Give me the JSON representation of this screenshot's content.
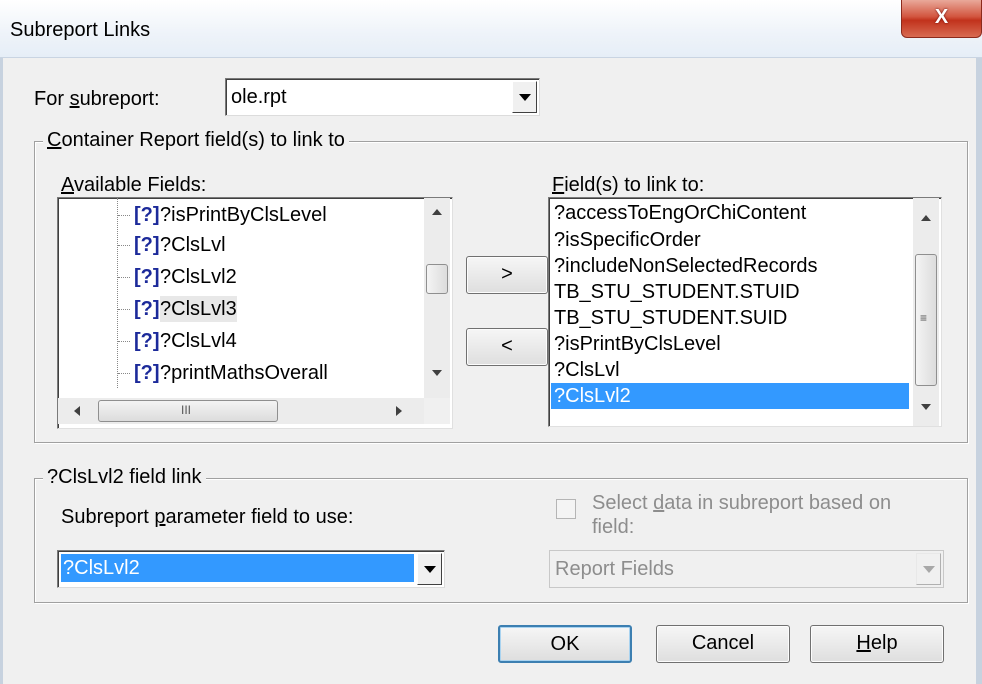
{
  "window": {
    "title": "Subreport Links",
    "close_glyph": "X"
  },
  "subreport": {
    "label": "For subreport:",
    "label_u": "s",
    "label_rest": "ubreport:",
    "label_pre": "For ",
    "value": "ole.rpt"
  },
  "container_group": {
    "title": "Container Report field(s) to link to",
    "title_u": "C",
    "title_rest": "ontainer Report field(s) to link to"
  },
  "available": {
    "label_u": "A",
    "label_rest": "vailable Fields:",
    "items": [
      {
        "mark": "[?]",
        "text": "?isPrintByClsLevel"
      },
      {
        "mark": "[?]",
        "text": "?ClsLvl"
      },
      {
        "mark": "[?]",
        "text": "?ClsLvl2"
      },
      {
        "mark": "[?]",
        "text": "?ClsLvl3"
      },
      {
        "mark": "[?]",
        "text": "?ClsLvl4"
      },
      {
        "mark": "[?]",
        "text": "?printMathsOverall"
      }
    ],
    "scroll_grip": "III"
  },
  "move_buttons": {
    "add": ">",
    "remove": "<"
  },
  "linked": {
    "label_u": "F",
    "label_rest": "ield(s) to link to:",
    "items": [
      "?accessToEngOrChiContent",
      "?isSpecificOrder",
      "?includeNonSelectedRecords",
      "TB_STU_STUDENT.STUID",
      "TB_STU_STUDENT.SUID",
      "?isPrintByClsLevel",
      "?ClsLvl",
      "?ClsLvl2"
    ],
    "selected_index": 7,
    "scroll_grip": "≡"
  },
  "field_link_group": {
    "title": "?ClsLvl2 field link",
    "param_label_pre": "Subreport ",
    "param_label_u": "p",
    "param_label_rest": "arameter field to use:",
    "param_value": "?ClsLvl2",
    "select_data_pre": "Select ",
    "select_data_u": "d",
    "select_data_rest": "ata in subreport based on",
    "select_data_line2": "field:",
    "report_fields": "Report Fields"
  },
  "buttons": {
    "ok": "OK",
    "cancel": "Cancel",
    "help_u": "H",
    "help_rest": "elp"
  },
  "colors": {
    "selection": "#3399ff",
    "close": "#c1321c",
    "default_border": "#3c7fb1"
  }
}
